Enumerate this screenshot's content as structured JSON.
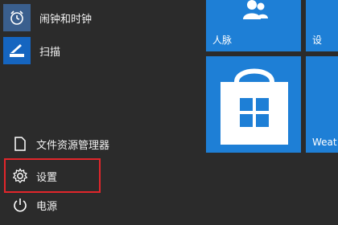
{
  "apps": [
    {
      "label": "闹钟和时钟",
      "icon": "alarm-clock-icon"
    },
    {
      "label": "扫描",
      "icon": "scanner-icon"
    }
  ],
  "system": [
    {
      "label": "文件资源管理器",
      "icon": "file-explorer-icon"
    },
    {
      "label": "设置",
      "icon": "gear-icon"
    },
    {
      "label": "电源",
      "icon": "power-icon"
    }
  ],
  "tiles": {
    "people_label": "人脉",
    "settings_partial_label": "设",
    "weather_partial_label": "Weat",
    "store_icon": "store-bag-icon"
  },
  "colors": {
    "tile_blue": "#1e7fd6",
    "background": "#2b2b2b",
    "highlight_red": "#e2262b"
  }
}
